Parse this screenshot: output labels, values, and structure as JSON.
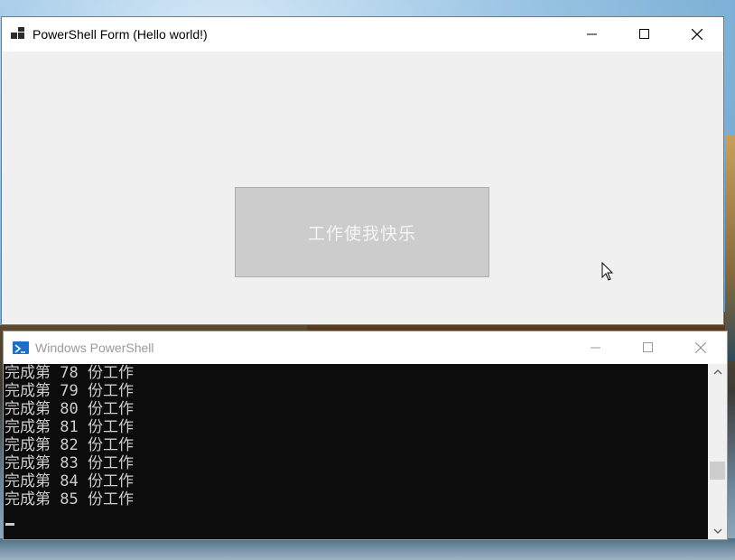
{
  "form_window": {
    "title": "PowerShell Form (Hello world!)",
    "button_label": "工作使我快乐"
  },
  "powershell_window": {
    "title": "Windows PowerShell",
    "lines": [
      "完成第 78 份工作",
      "完成第 79 份工作",
      "完成第 80 份工作",
      "完成第 81 份工作",
      "完成第 82 份工作",
      "完成第 83 份工作",
      "完成第 84 份工作",
      "完成第 85 份工作"
    ]
  },
  "icons": {
    "form_app": "windows-form-icon",
    "powershell_app": "powershell-icon",
    "minimize": "minimize-icon",
    "maximize": "maximize-icon",
    "close": "close-icon",
    "scroll_up": "chevron-up-icon",
    "scroll_down": "chevron-down-icon",
    "cursor": "mouse-pointer-icon"
  },
  "colors": {
    "form_background": "#f0f0f0",
    "button_background": "#cccccc",
    "console_background": "#0c0c0c",
    "console_text": "#cccccc",
    "powershell_accent": "#1e6fc6"
  }
}
